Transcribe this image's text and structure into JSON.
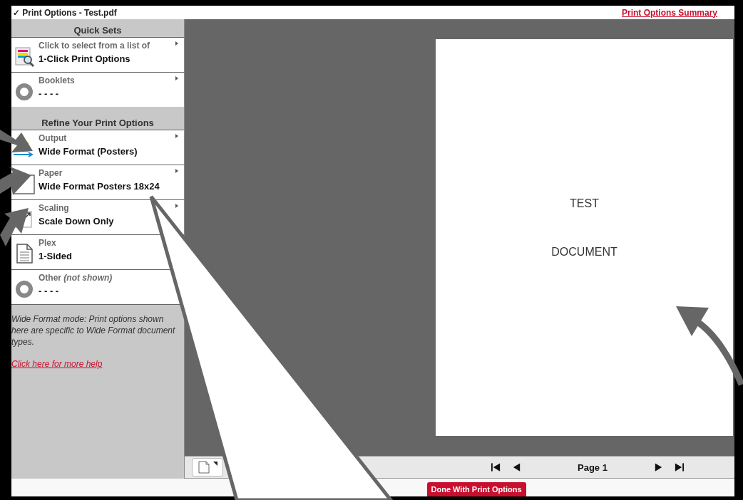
{
  "title_bar": {
    "check": "✓",
    "title": "Print Options - Test.pdf",
    "summary_link": "Print Options Summary"
  },
  "sidebar": {
    "sections": [
      {
        "heading": "Quick Sets",
        "items": [
          {
            "kind": "list-search",
            "label": "Click to select from a list of",
            "value": "1-Click Print Options",
            "submenu": true
          },
          {
            "kind": "ring",
            "label": "Booklets",
            "value": "- - - -",
            "submenu": true
          }
        ]
      },
      {
        "heading": "Refine Your Print Options",
        "items": [
          {
            "kind": "output",
            "label": "Output",
            "value": "Wide Format (Posters)",
            "submenu": true
          },
          {
            "kind": "paper",
            "label": "Paper",
            "value": "Wide Format Posters 18x24",
            "submenu": true
          },
          {
            "kind": "scaling",
            "label": "Scaling",
            "value": "Scale Down Only",
            "submenu": true
          },
          {
            "kind": "plex",
            "label": "Plex",
            "value": "1-Sided",
            "submenu": false
          },
          {
            "kind": "ring",
            "label": "Other *(not shown)*",
            "value": "- - - -",
            "submenu": false
          }
        ]
      }
    ],
    "note": "Wide Format mode: Print options shown here are specific to Wide Format document types.",
    "help_link": "Click here for more help"
  },
  "preview": {
    "lines": [
      "TEST",
      "DOCUMENT"
    ]
  },
  "toolbar": {
    "page_label": "Page 1"
  },
  "footer": {
    "done_button": "Done With Print Options"
  }
}
